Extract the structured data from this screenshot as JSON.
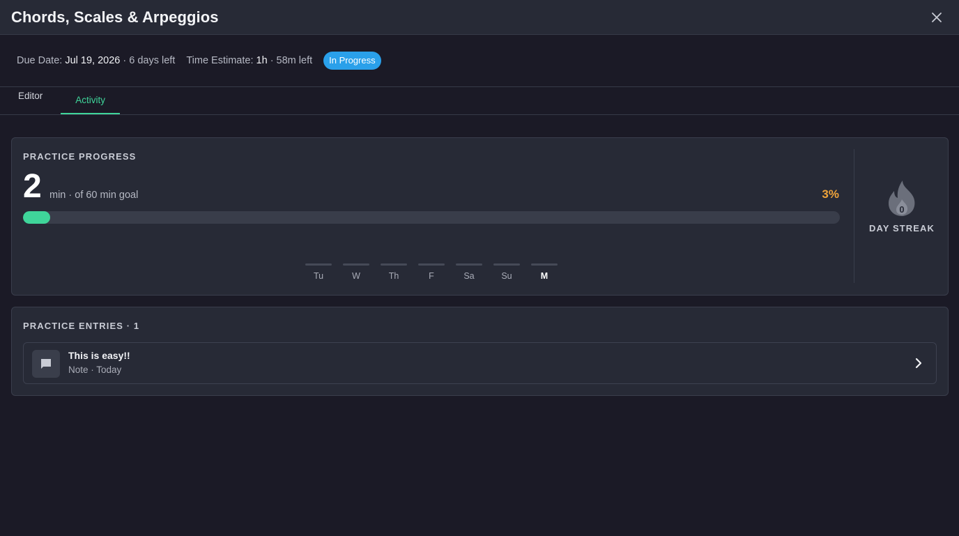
{
  "header": {
    "title": "Chords, Scales & Arpeggios",
    "close_icon": "close-icon"
  },
  "meta": {
    "due_label": "Due Date:",
    "due_value": "Jul 19, 2026",
    "due_left": "· 6 days left",
    "time_label": "Time Estimate:",
    "time_value": "1h",
    "time_left": "· 58m left",
    "status": "In Progress",
    "status_color": "#2aa0ea"
  },
  "tabs": [
    {
      "label": "Editor",
      "active": false
    },
    {
      "label": "Activity",
      "active": true
    }
  ],
  "progress": {
    "section_label": "PRACTICE PROGRESS",
    "minutes": "2",
    "goal_text": "min · of 60 min goal",
    "percent_text": "3%",
    "percent_value": 3,
    "days": [
      {
        "label": "Tu",
        "today": false
      },
      {
        "label": "W",
        "today": false
      },
      {
        "label": "Th",
        "today": false
      },
      {
        "label": "F",
        "today": false
      },
      {
        "label": "Sa",
        "today": false
      },
      {
        "label": "Su",
        "today": false
      },
      {
        "label": "M",
        "today": true
      }
    ],
    "streak_label": "DAY STREAK",
    "streak_count": "0",
    "accent_color": "#3fd59a",
    "percent_color": "#f0a43a"
  },
  "entries": {
    "section_label": "PRACTICE ENTRIES · 1",
    "items": [
      {
        "title": "This is easy!!",
        "subtitle": "Note · Today",
        "icon": "comment-icon"
      }
    ]
  }
}
